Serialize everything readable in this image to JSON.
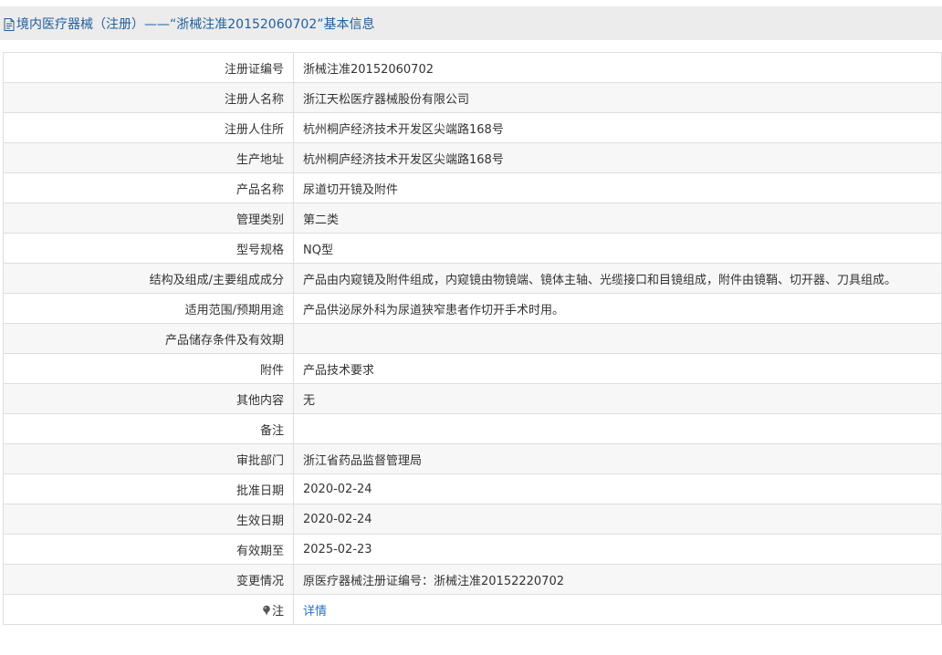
{
  "header": {
    "title": "境内医疗器械（注册）——“浙械注准20152060702”基本信息"
  },
  "rows": [
    {
      "label": "注册证编号",
      "value": "浙械注准20152060702"
    },
    {
      "label": "注册人名称",
      "value": "浙江天松医疗器械股份有限公司"
    },
    {
      "label": "注册人住所",
      "value": "杭州桐庐经济技术开发区尖端路168号"
    },
    {
      "label": "生产地址",
      "value": "杭州桐庐经济技术开发区尖端路168号"
    },
    {
      "label": "产品名称",
      "value": "尿道切开镜及附件"
    },
    {
      "label": "管理类别",
      "value": "第二类"
    },
    {
      "label": "型号规格",
      "value": "NQ型"
    },
    {
      "label": "结构及组成/主要组成成分",
      "value": "产品由内窥镜及附件组成，内窥镜由物镜端、镜体主轴、光缆接口和目镜组成，附件由镜鞘、切开器、刀具组成。"
    },
    {
      "label": "适用范围/预期用途",
      "value": "产品供泌尿外科为尿道狭窄患者作切开手术时用。"
    },
    {
      "label": "产品储存条件及有效期",
      "value": ""
    },
    {
      "label": "附件",
      "value": "产品技术要求"
    },
    {
      "label": "其他内容",
      "value": "无"
    },
    {
      "label": "备注",
      "value": ""
    },
    {
      "label": "审批部门",
      "value": "浙江省药品监督管理局"
    },
    {
      "label": "批准日期",
      "value": "2020-02-24"
    },
    {
      "label": "生效日期",
      "value": "2020-02-24"
    },
    {
      "label": "有效期至",
      "value": "2025-02-23"
    },
    {
      "label": "变更情况",
      "value": "原医疗器械注册证编号：浙械注准20152220702"
    }
  ],
  "note_row": {
    "label": "注",
    "icon": "pin-icon",
    "link_text": "详情"
  },
  "colors": {
    "header_bg": "#ececec",
    "header_text": "#1f5f9e",
    "link": "#2a73c5",
    "border": "#dedede"
  }
}
